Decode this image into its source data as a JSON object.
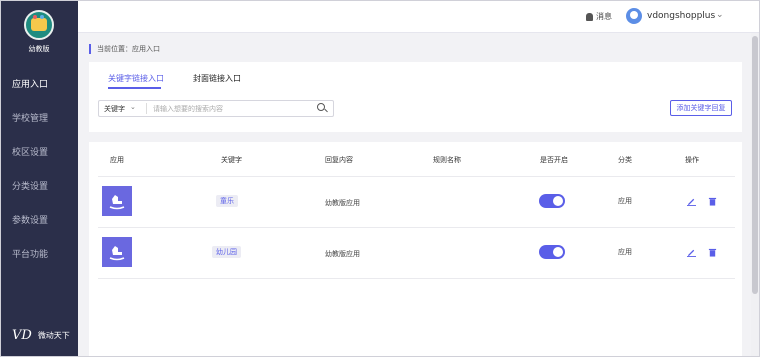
{
  "sidebar": {
    "brand": "幼教版",
    "items": [
      {
        "label": "应用入口",
        "active": true
      },
      {
        "label": "学校管理",
        "active": false
      },
      {
        "label": "校区设置",
        "active": false
      },
      {
        "label": "分类设置",
        "active": false
      },
      {
        "label": "参数设置",
        "active": false
      },
      {
        "label": "平台功能",
        "active": false
      }
    ],
    "footer": {
      "mark": "VD",
      "label": "微动天下"
    }
  },
  "header": {
    "message_label": "消息",
    "username": "vdongshopplus",
    "chevron": "⌄"
  },
  "breadcrumb": {
    "text": "当前位置：应用入口"
  },
  "tabs": [
    {
      "label": "关键字链接入口",
      "active": true
    },
    {
      "label": "封面链接入口",
      "active": false
    }
  ],
  "search": {
    "select_value": "关键字",
    "chevron": "⌄",
    "placeholder": "请输入想要的搜索内容"
  },
  "add_button_label": "添加关键字回复",
  "table": {
    "headers": [
      "应用",
      "关键字",
      "回复内容",
      "规则名称",
      "是否开启",
      "分类",
      "操作"
    ],
    "rows": [
      {
        "keyword": "童乐",
        "reply": "幼教版应用",
        "rule": "",
        "enabled": true,
        "category": "应用"
      },
      {
        "keyword": "幼儿园",
        "reply": "幼教版应用",
        "rule": "",
        "enabled": true,
        "category": "应用"
      }
    ]
  },
  "colors": {
    "accent": "#5a5ee8",
    "sidebar_bg": "#2b2f4a",
    "thumb_bg": "#6a68e0"
  }
}
